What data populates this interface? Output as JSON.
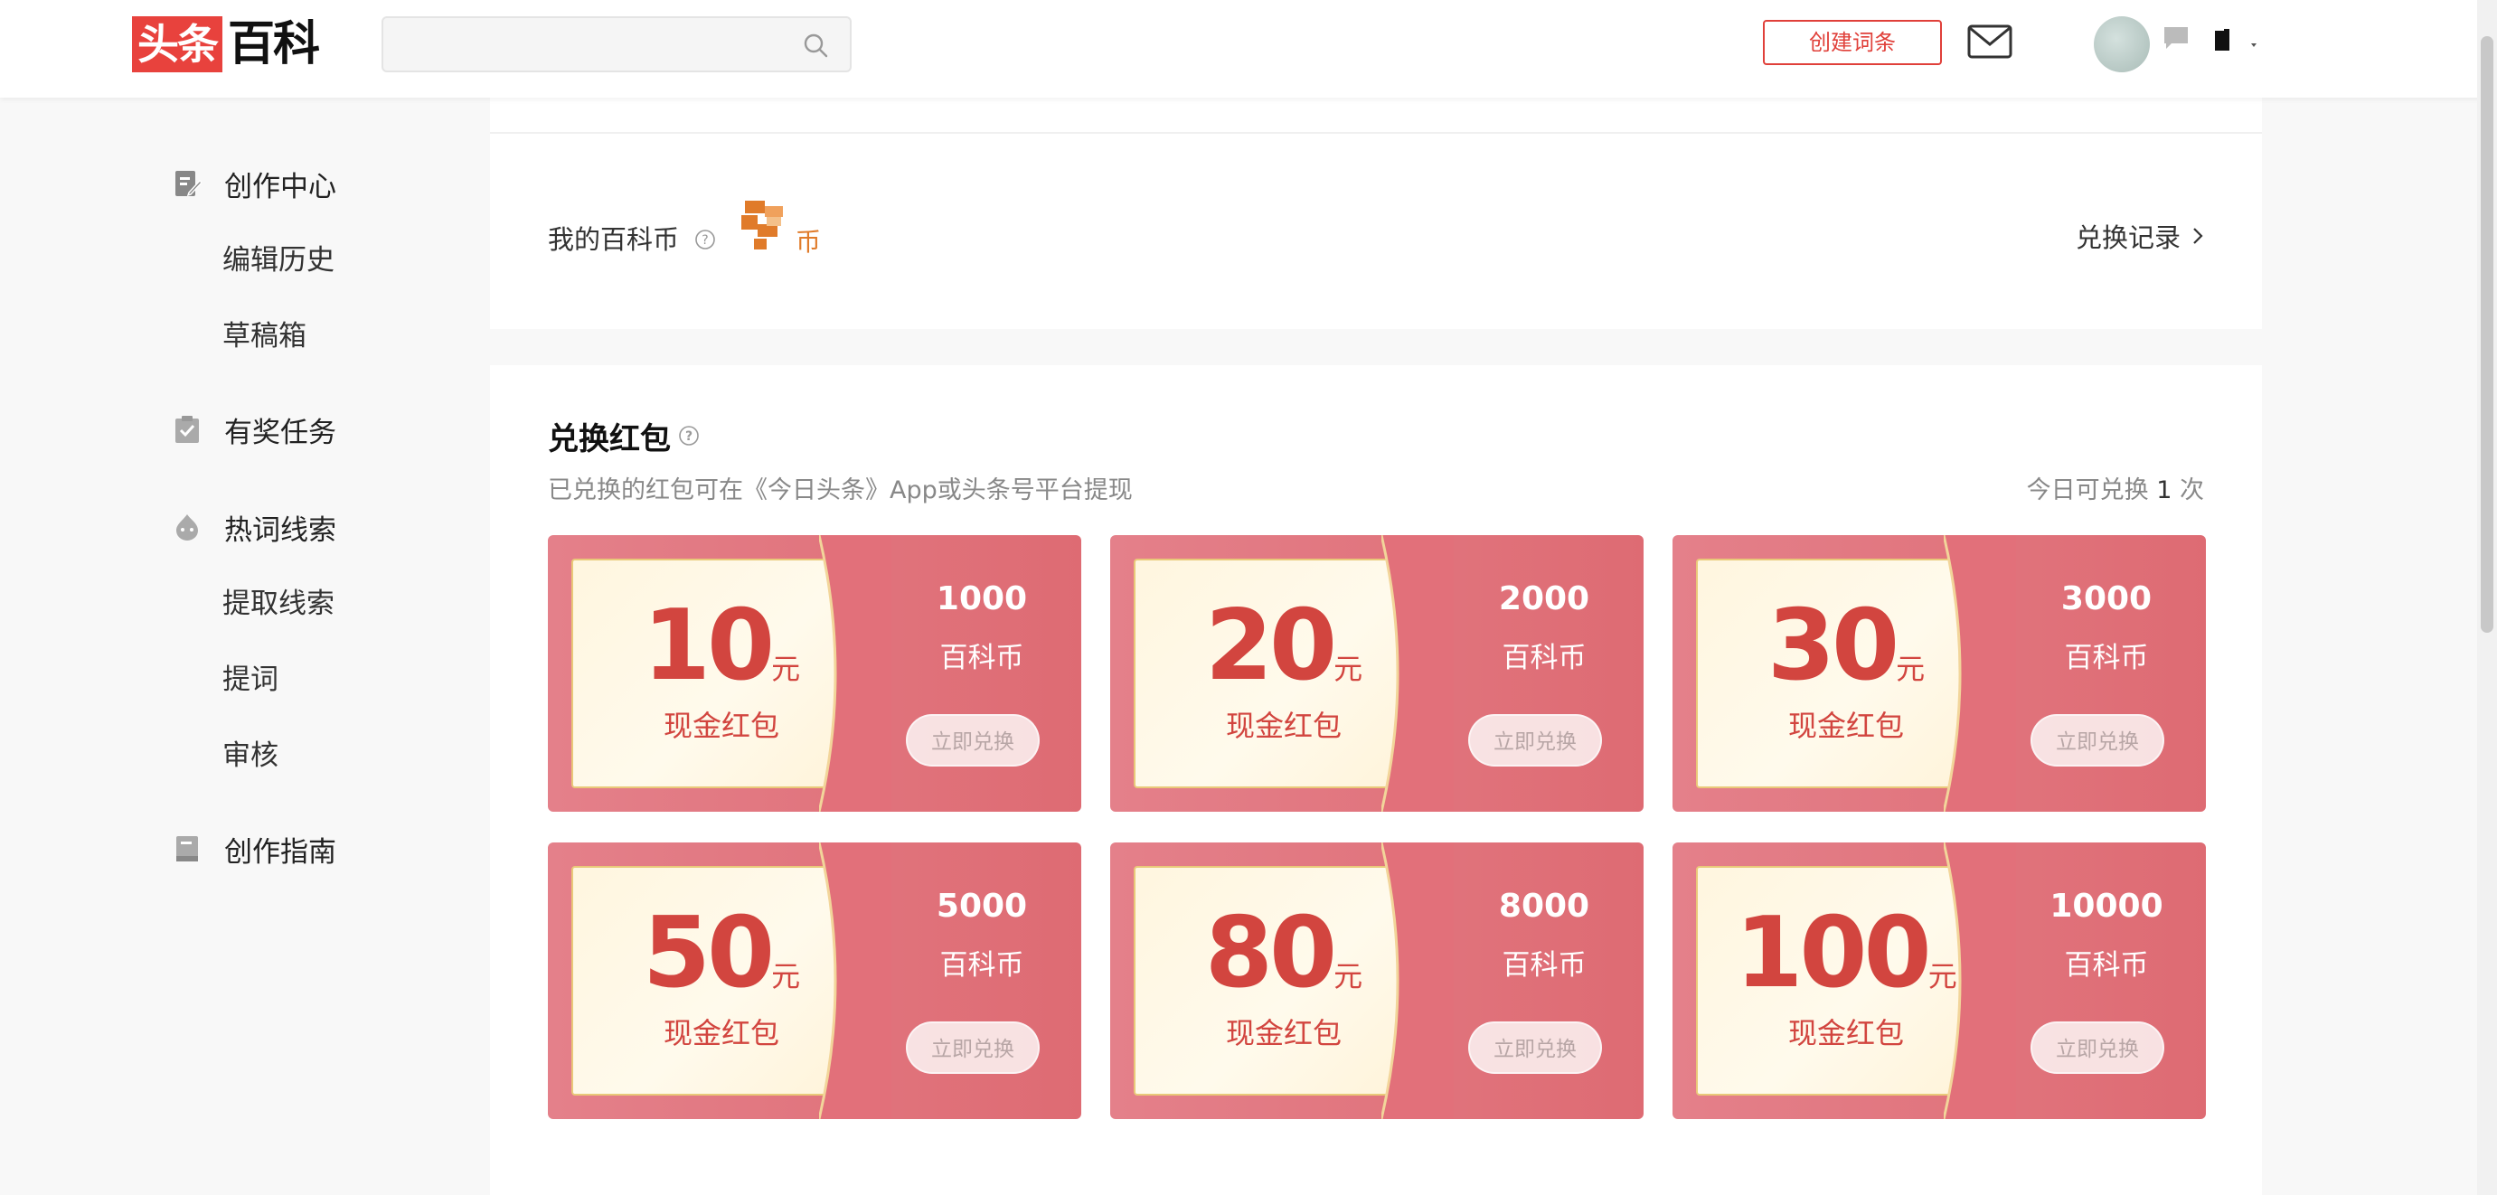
{
  "header": {
    "logo_part1": "头条",
    "logo_part2": "百科",
    "search": {
      "value": "",
      "placeholder": ""
    },
    "create_label": "创建词条"
  },
  "sidebar": {
    "groups": [
      {
        "label": "创作中心",
        "icon": "edit-doc-icon",
        "items": [
          "编辑历史",
          "草稿箱"
        ]
      },
      {
        "label": "有奖任务",
        "icon": "clipboard-check-icon",
        "items": []
      },
      {
        "label": "热词线索",
        "icon": "fire-icon",
        "items": [
          "提取线索",
          "提词",
          "审核"
        ]
      },
      {
        "label": "创作指南",
        "icon": "book-icon",
        "items": []
      }
    ]
  },
  "coins": {
    "label": "我的百科币",
    "unit": "币",
    "record_link": "兑换记录"
  },
  "redeem": {
    "title": "兑换红包",
    "subtitle": "已兑换的红包可在《今日头条》App或头条号平台提现",
    "quota_prefix": "今日可兑换",
    "quota_count": "1",
    "quota_suffix": "次",
    "yuan": "元",
    "kind": "现金红包",
    "coin_unit": "百科币",
    "button": "立即兑换",
    "tickets": [
      {
        "amount": "10",
        "cost": "1000"
      },
      {
        "amount": "20",
        "cost": "2000"
      },
      {
        "amount": "30",
        "cost": "3000"
      },
      {
        "amount": "50",
        "cost": "5000"
      },
      {
        "amount": "80",
        "cost": "8000"
      },
      {
        "amount": "100",
        "cost": "10000"
      }
    ]
  },
  "colors": {
    "brand_red": "#e8423d",
    "ticket_red": "#e06068",
    "cream": "#fff6df",
    "coin_orange": "#e07b2a"
  }
}
